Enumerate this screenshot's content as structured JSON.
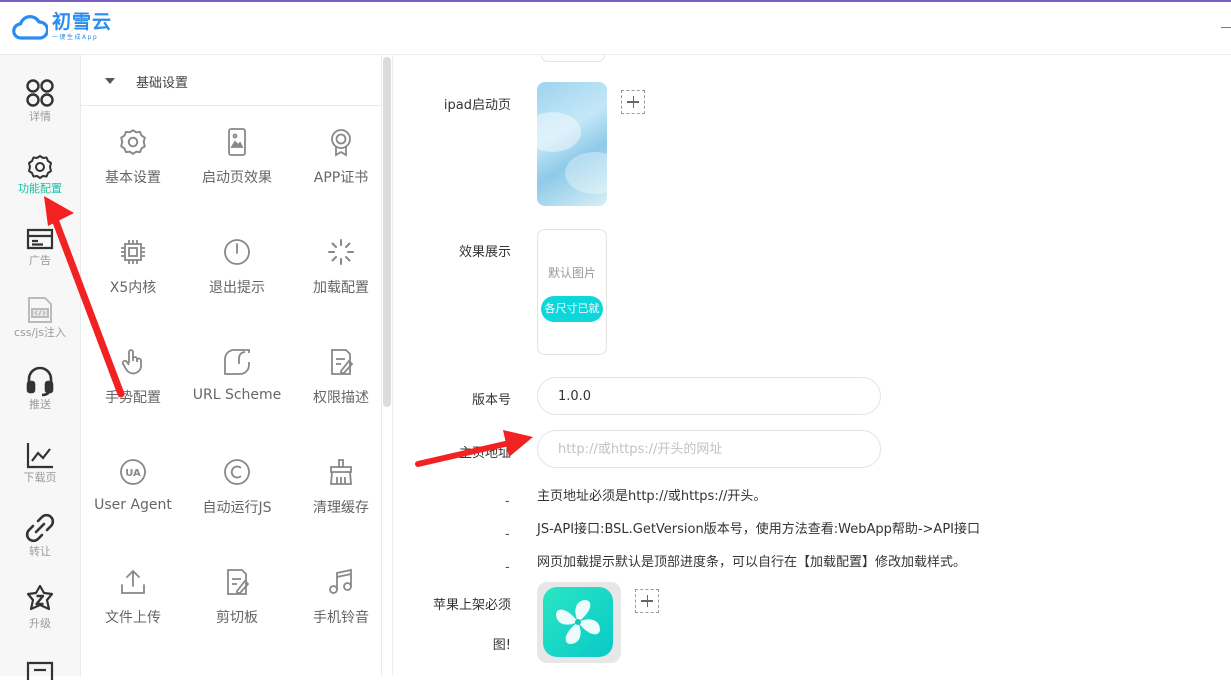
{
  "header": {
    "app_name": "初雪云",
    "slogan": "一键生成App"
  },
  "nav": {
    "items": [
      {
        "label": "详情",
        "icon": "grid-icon"
      },
      {
        "label": "功能配置",
        "icon": "gear-icon",
        "active": true
      },
      {
        "label": "广告",
        "icon": "ad-icon"
      },
      {
        "label": "css/js注入",
        "icon": "code-file-icon"
      },
      {
        "label": "推送",
        "icon": "headset-icon"
      },
      {
        "label": "下载页",
        "icon": "line-chart-icon"
      },
      {
        "label": "转让",
        "icon": "link-icon"
      },
      {
        "label": "升级",
        "icon": "star-badge-icon"
      }
    ]
  },
  "panel": {
    "title": "基础设置",
    "items": [
      {
        "label": "基本设置",
        "icon": "gear-icon"
      },
      {
        "label": "启动页效果",
        "icon": "phone-image-icon"
      },
      {
        "label": "APP证书",
        "icon": "certificate-icon"
      },
      {
        "label": "X5内核",
        "icon": "chip-icon"
      },
      {
        "label": "退出提示",
        "icon": "power-icon"
      },
      {
        "label": "加载配置",
        "icon": "loading-icon"
      },
      {
        "label": "手势配置",
        "icon": "gesture-icon"
      },
      {
        "label": "URL Scheme",
        "icon": "scheme-icon"
      },
      {
        "label": "权限描述",
        "icon": "permission-edit-icon"
      },
      {
        "label": "User Agent",
        "icon": "ua-icon"
      },
      {
        "label": "自动运行JS",
        "icon": "copyright-icon"
      },
      {
        "label": "清理缓存",
        "icon": "broom-icon"
      },
      {
        "label": "文件上传",
        "icon": "upload-icon"
      },
      {
        "label": "剪切板",
        "icon": "clipboard-edit-icon"
      },
      {
        "label": "手机铃音",
        "icon": "music-icon"
      }
    ]
  },
  "form": {
    "ipad_label": "ipad启动页",
    "effect_label": "效果展示",
    "preview_default": "默认图片",
    "preview_tag": "各尺寸已就",
    "version_label": "版本号",
    "version_value": "1.0.0",
    "homepage_label": "主页地址",
    "homepage_placeholder": "http://或https://开头的网址",
    "hint_dash": "-",
    "hints": [
      "主页地址必须是http://或https://开头。",
      "JS-API接口:BSL.GetVersion版本号，使用方法查看:WebApp帮助->API接口",
      "网页加载提示默认是顶部进度条，可以自行在【加载配置】修改加载样式。"
    ],
    "apple_label_line1": "苹果上架必须",
    "apple_label_line2": "图!"
  },
  "colors": {
    "accent": "#14c1a6",
    "brand": "#2a8cf0",
    "arrow": "#f22222",
    "pill": "#0ed7dc"
  }
}
